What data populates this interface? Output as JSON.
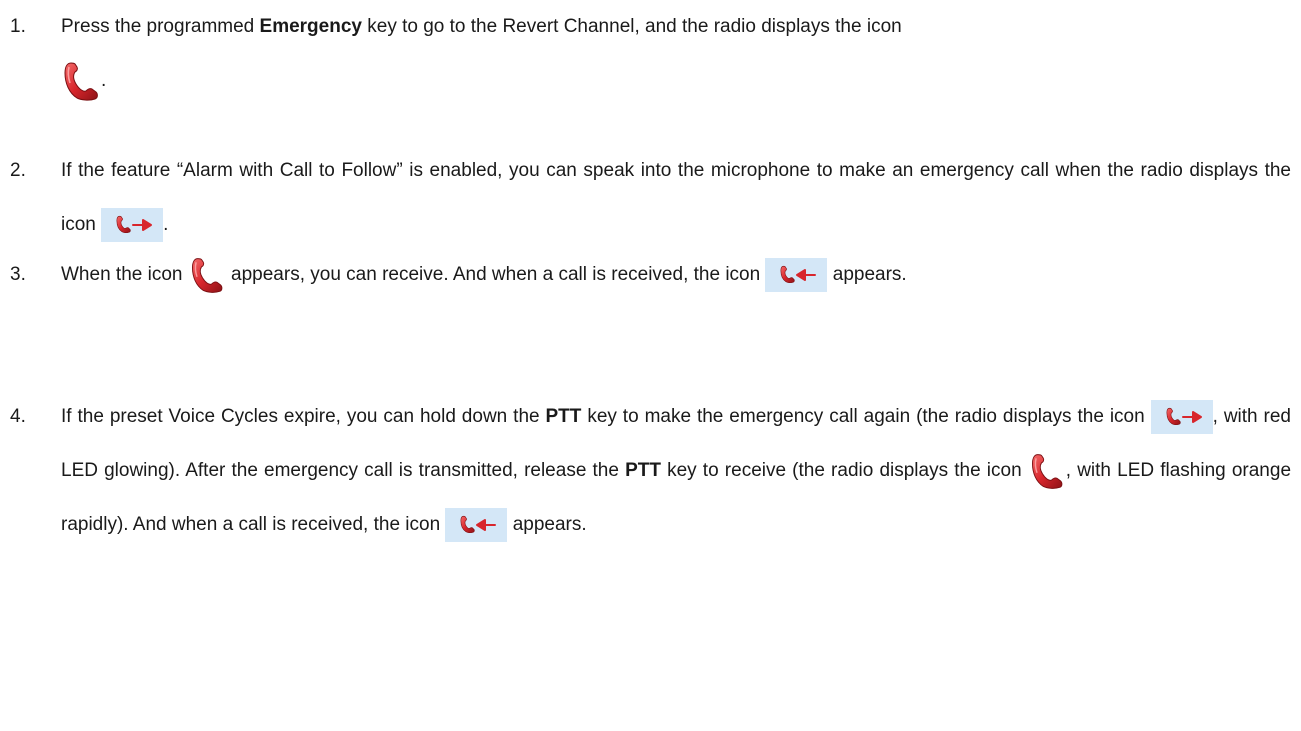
{
  "steps": [
    {
      "number": "1.",
      "parts": {
        "a": "Press the programmed ",
        "b": "Emergency",
        "c": " key to go to the Revert Channel, and the radio displays the icon",
        "d": "."
      },
      "icons": [
        "emergency-phone-icon"
      ]
    },
    {
      "number": "2.",
      "parts": {
        "a": "If the feature “Alarm with Call to Follow” is enabled, you can speak into the microphone to make an emergency call when the radio displays the icon",
        "b": "."
      },
      "icons": [
        "emergency-call-transmit-icon"
      ]
    },
    {
      "number": "3.",
      "parts": {
        "a": "When the icon",
        "b": "appears, you can receive. And when a call is received, the icon",
        "c": "appears."
      },
      "icons": [
        "emergency-phone-icon",
        "emergency-call-receive-icon"
      ]
    },
    {
      "number": "4.",
      "parts": {
        "a": "If the preset Voice Cycles expire, you can hold down the ",
        "b": "PTT",
        "c": " key to make the emergency call again (the radio displays the icon",
        "d": ", with red LED glowing). After the emergency call is transmitted, release the ",
        "e": "PTT",
        "f": " key to receive (the radio displays the icon",
        "g": ", with LED flashing orange rapidly). And when a call is received, the icon",
        "h": "appears."
      },
      "icons": [
        "emergency-call-transmit-icon",
        "emergency-phone-icon",
        "emergency-call-receive-icon"
      ]
    }
  ],
  "colors": {
    "text": "#1a1a1a",
    "icon_red": "#d8262c",
    "icon_box_background": "#d4e7f7"
  }
}
